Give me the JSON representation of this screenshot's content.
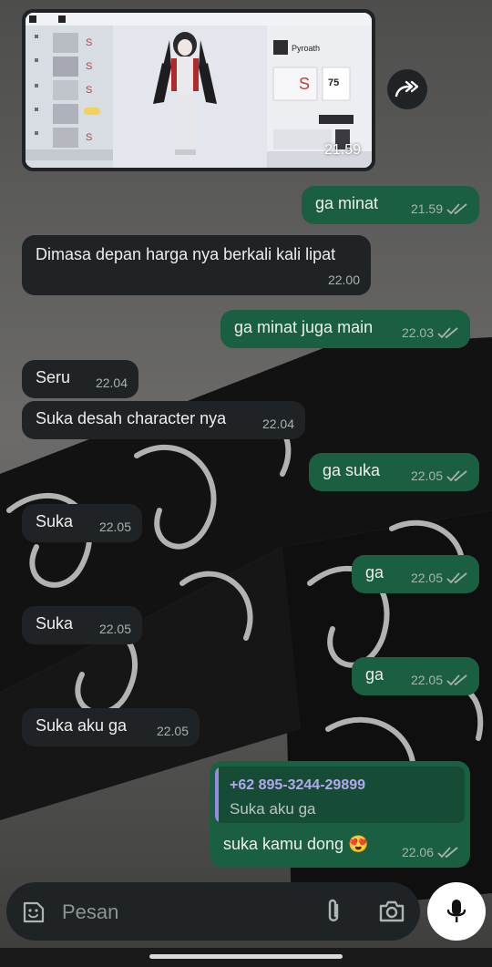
{
  "image_message": {
    "time": "21.59",
    "preview": {
      "back_label": "Back",
      "tab_label": "Train",
      "rank_label": "S",
      "character_name": "Pyroath",
      "level_value": "75",
      "equip_button": "Gear Equipment",
      "filter_label": "Filter",
      "sort_label": "Sort"
    }
  },
  "messages": [
    {
      "side": "out",
      "text": "ga minat",
      "time": "21.59",
      "read": true
    },
    {
      "side": "in",
      "text": "Dimasa depan harga nya berkali kali lipat",
      "time": "22.00"
    },
    {
      "side": "out",
      "text": "ga minat juga main",
      "time": "22.03",
      "read": true
    },
    {
      "side": "in",
      "text": "Seru",
      "time": "22.04"
    },
    {
      "side": "in",
      "text": "Suka desah character nya",
      "time": "22.04"
    },
    {
      "side": "out",
      "text": "ga suka",
      "time": "22.05",
      "read": true
    },
    {
      "side": "in",
      "text": "Suka",
      "time": "22.05"
    },
    {
      "side": "out",
      "text": "ga",
      "time": "22.05",
      "read": true
    },
    {
      "side": "in",
      "text": "Suka",
      "time": "22.05"
    },
    {
      "side": "out",
      "text": "ga",
      "time": "22.05",
      "read": true
    },
    {
      "side": "in",
      "text": "Suka aku ga",
      "time": "22.05"
    }
  ],
  "reply_message": {
    "quoted_sender": "+62 895-3244-29899",
    "quoted_text": "Suka aku ga",
    "text": "suka kamu dong 😍",
    "time": "22.06",
    "read": true
  },
  "input": {
    "placeholder": "Pesan"
  },
  "icons": {
    "emoji": "emoji-icon",
    "attach": "paperclip-icon",
    "camera": "camera-icon",
    "mic": "microphone-icon",
    "forward": "forward-icon",
    "ticks": "double-check-icon"
  },
  "colors": {
    "incoming_bubble": "#1f2326",
    "outgoing_bubble": "#1b5f43",
    "read_ticks": "#a9b2ad",
    "quote_name": "#b4a7f2"
  }
}
